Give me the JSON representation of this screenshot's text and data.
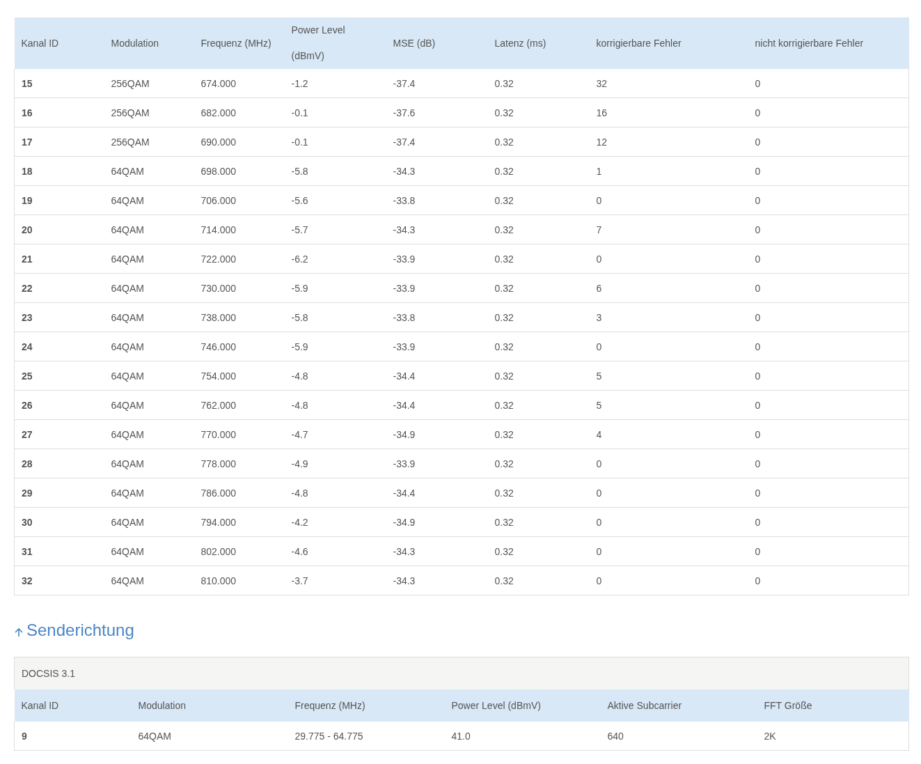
{
  "downstream_table": {
    "columns": [
      "Kanal ID",
      "Modulation",
      "Frequenz (MHz)",
      "Power Level (dBmV)",
      "MSE (dB)",
      "Latenz (ms)",
      "korrigierbare Fehler",
      "nicht korrigierbare Fehler"
    ],
    "rows": [
      [
        "15",
        "256QAM",
        "674.000",
        "-1.2",
        "-37.4",
        "0.32",
        "32",
        "0"
      ],
      [
        "16",
        "256QAM",
        "682.000",
        "-0.1",
        "-37.6",
        "0.32",
        "16",
        "0"
      ],
      [
        "17",
        "256QAM",
        "690.000",
        "-0.1",
        "-37.4",
        "0.32",
        "12",
        "0"
      ],
      [
        "18",
        "64QAM",
        "698.000",
        "-5.8",
        "-34.3",
        "0.32",
        "1",
        "0"
      ],
      [
        "19",
        "64QAM",
        "706.000",
        "-5.6",
        "-33.8",
        "0.32",
        "0",
        "0"
      ],
      [
        "20",
        "64QAM",
        "714.000",
        "-5.7",
        "-34.3",
        "0.32",
        "7",
        "0"
      ],
      [
        "21",
        "64QAM",
        "722.000",
        "-6.2",
        "-33.9",
        "0.32",
        "0",
        "0"
      ],
      [
        "22",
        "64QAM",
        "730.000",
        "-5.9",
        "-33.9",
        "0.32",
        "6",
        "0"
      ],
      [
        "23",
        "64QAM",
        "738.000",
        "-5.8",
        "-33.8",
        "0.32",
        "3",
        "0"
      ],
      [
        "24",
        "64QAM",
        "746.000",
        "-5.9",
        "-33.9",
        "0.32",
        "0",
        "0"
      ],
      [
        "25",
        "64QAM",
        "754.000",
        "-4.8",
        "-34.4",
        "0.32",
        "5",
        "0"
      ],
      [
        "26",
        "64QAM",
        "762.000",
        "-4.8",
        "-34.4",
        "0.32",
        "5",
        "0"
      ],
      [
        "27",
        "64QAM",
        "770.000",
        "-4.7",
        "-34.9",
        "0.32",
        "4",
        "0"
      ],
      [
        "28",
        "64QAM",
        "778.000",
        "-4.9",
        "-33.9",
        "0.32",
        "0",
        "0"
      ],
      [
        "29",
        "64QAM",
        "786.000",
        "-4.8",
        "-34.4",
        "0.32",
        "0",
        "0"
      ],
      [
        "30",
        "64QAM",
        "794.000",
        "-4.2",
        "-34.9",
        "0.32",
        "0",
        "0"
      ],
      [
        "31",
        "64QAM",
        "802.000",
        "-4.6",
        "-34.3",
        "0.32",
        "0",
        "0"
      ],
      [
        "32",
        "64QAM",
        "810.000",
        "-3.7",
        "-34.3",
        "0.32",
        "0",
        "0"
      ]
    ]
  },
  "upstream_section": {
    "title": "Senderichtung",
    "table": {
      "caption": "DOCSIS 3.1",
      "columns": [
        "Kanal ID",
        "Modulation",
        "Frequenz (MHz)",
        "Power Level (dBmV)",
        "Aktive Subcarrier",
        "FFT Größe"
      ],
      "rows": [
        [
          "9",
          "64QAM",
          "29.775 - 64.775",
          "41.0",
          "640",
          "2K"
        ]
      ]
    }
  }
}
